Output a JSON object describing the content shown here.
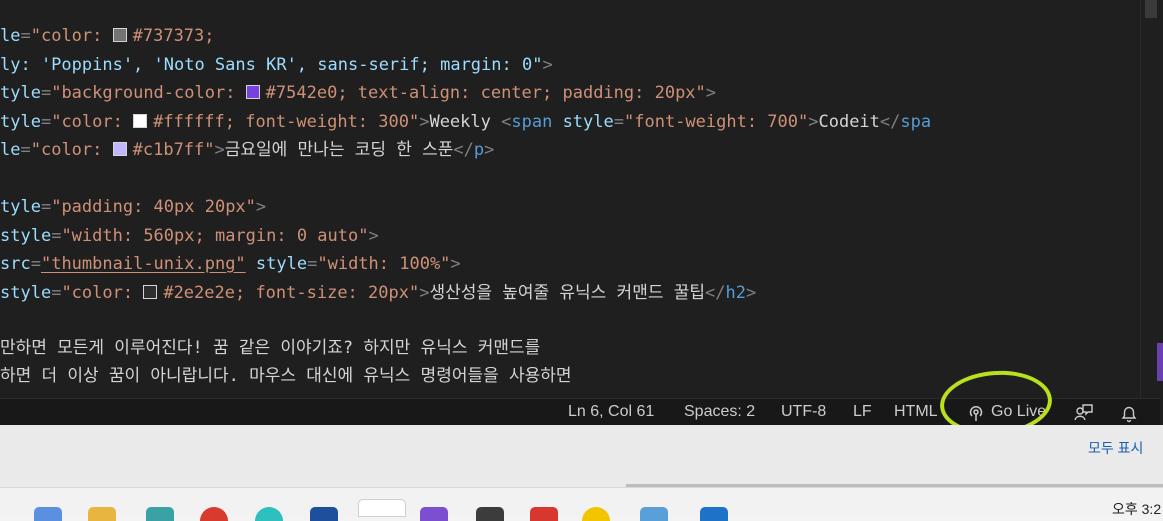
{
  "editor": {
    "lines": [
      [
        [
          "c-attr",
          "le"
        ],
        [
          "c-punct",
          "="
        ],
        [
          "c-str",
          "\"color: "
        ],
        [
          "sw",
          "#737373"
        ],
        [
          "c-str",
          "#737373;"
        ]
      ],
      [
        [
          "c-attr",
          "ly: 'Poppins', 'Noto Sans KR', sans-serif; margin: 0\""
        ],
        [
          "c-punct",
          ">"
        ]
      ],
      [
        [
          "c-attr",
          "tyle"
        ],
        [
          "c-punct",
          "="
        ],
        [
          "c-str",
          "\"background-color: "
        ],
        [
          "sw",
          "#7542e0"
        ],
        [
          "c-str",
          "#7542e0; text-align: center; padding: 20px\""
        ],
        [
          "c-punct",
          ">"
        ]
      ],
      [
        [
          "c-attr",
          "tyle"
        ],
        [
          "c-punct",
          "="
        ],
        [
          "c-str",
          "\"color: "
        ],
        [
          "sw",
          "#ffffff"
        ],
        [
          "c-str",
          "#ffffff; font-weight: 300\""
        ],
        [
          "c-punct",
          ">"
        ],
        [
          "c-text",
          "Weekly "
        ],
        [
          "c-punct",
          "<"
        ],
        [
          "c-tag",
          "span"
        ],
        [
          "c-text",
          " "
        ],
        [
          "c-attr",
          "style"
        ],
        [
          "c-punct",
          "="
        ],
        [
          "c-str",
          "\"font-weight: 700\""
        ],
        [
          "c-punct",
          ">"
        ],
        [
          "c-text",
          "Codeit"
        ],
        [
          "c-punct",
          "</"
        ],
        [
          "c-tag",
          "spa"
        ]
      ],
      [
        [
          "c-attr",
          "le"
        ],
        [
          "c-punct",
          "="
        ],
        [
          "c-str",
          "\"color: "
        ],
        [
          "sw",
          "#c1b7ff"
        ],
        [
          "c-str",
          "#c1b7ff\""
        ],
        [
          "c-punct",
          ">"
        ],
        [
          "c-text",
          "금요일에 만나는 코딩 한 스푼"
        ],
        [
          "c-punct",
          "</"
        ],
        [
          "c-tag",
          "p"
        ],
        [
          "c-punct",
          ">"
        ]
      ],
      [],
      [
        [
          "c-attr",
          "tyle"
        ],
        [
          "c-punct",
          "="
        ],
        [
          "c-str",
          "\"padding: 40px 20px\""
        ],
        [
          "c-punct",
          ">"
        ]
      ],
      [
        [
          "c-attr",
          "style"
        ],
        [
          "c-punct",
          "="
        ],
        [
          "c-str",
          "\"width: 560px; margin: 0 auto\""
        ],
        [
          "c-punct",
          ">"
        ]
      ],
      [
        [
          "c-attr",
          "src"
        ],
        [
          "c-punct",
          "="
        ],
        [
          "c-str-u",
          "\"thumbnail-unix.png\""
        ],
        [
          "c-text",
          " "
        ],
        [
          "c-attr",
          "style"
        ],
        [
          "c-punct",
          "="
        ],
        [
          "c-str",
          "\"width: 100%\""
        ],
        [
          "c-punct",
          ">"
        ]
      ],
      [
        [
          "c-attr",
          "style"
        ],
        [
          "c-punct",
          "="
        ],
        [
          "c-str",
          "\"color: "
        ],
        [
          "sw",
          "#2e2e2e"
        ],
        [
          "c-str",
          "#2e2e2e; font-size: 20px\""
        ],
        [
          "c-punct",
          ">"
        ],
        [
          "c-text",
          "생산성을 높여줄 유닉스 커맨드 꿀팁"
        ],
        [
          "c-punct",
          "</"
        ],
        [
          "c-tag",
          "h2"
        ],
        [
          "c-punct",
          ">"
        ]
      ],
      [],
      [
        [
          "c-text",
          "만하면 모든게 이루어진다! 꿈 같은 이야기죠? 하지만 유닉스 커맨드를"
        ]
      ],
      [
        [
          "c-text",
          "하면 더 이상 꿈이 아니랍니다. 마우스 대신에 유닉스 명령어들을 사용하면"
        ]
      ]
    ]
  },
  "statusbar": {
    "position": "Ln 6, Col 61",
    "spaces": "Spaces: 2",
    "encoding": "UTF-8",
    "eol": "LF",
    "language": "HTML",
    "go_live": "Go Live"
  },
  "notifications": {
    "show_all": "모두 표시"
  },
  "taskbar": {
    "clock_partial": "오후 3:2"
  },
  "colors": {
    "highlight_ring": "#b8e01c",
    "editor_bg": "#1f1f1f",
    "statusbar_bg": "#181818"
  },
  "icons": [
    "broadcast-icon",
    "feedback-person-icon",
    "bell-icon"
  ]
}
